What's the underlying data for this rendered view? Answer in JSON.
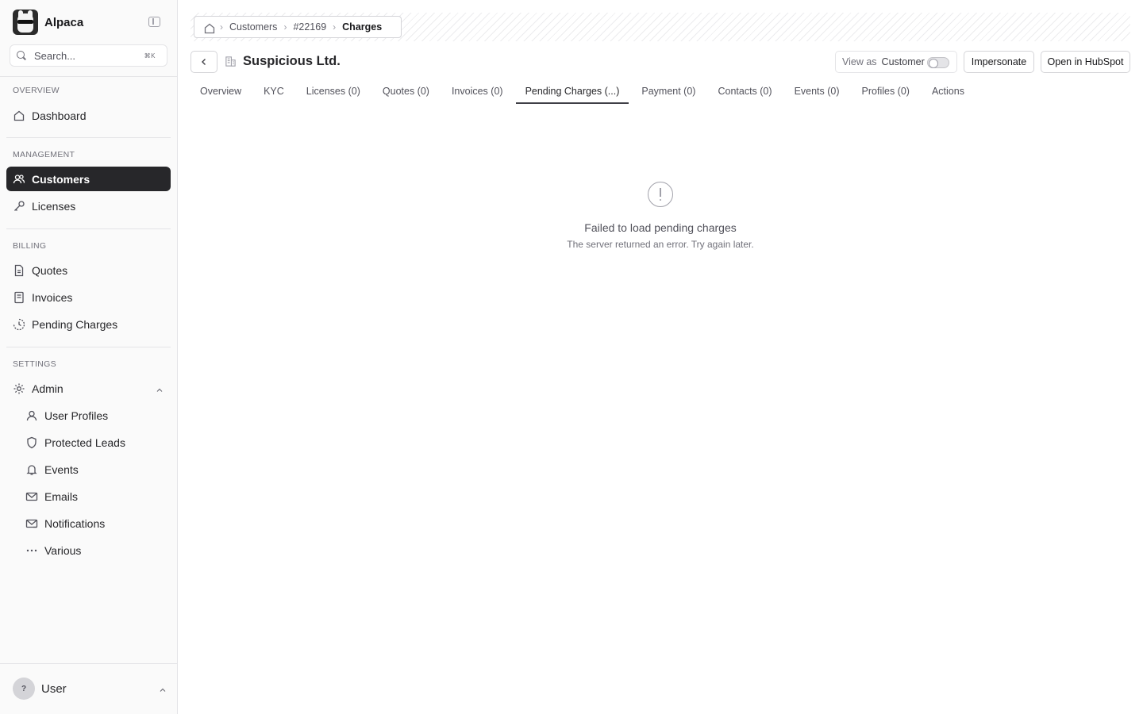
{
  "app": {
    "name": "Alpaca"
  },
  "search": {
    "placeholder": "Search...",
    "shortcut": "⌘K"
  },
  "sections": {
    "overview": "Overview",
    "management": "Management",
    "billing": "Billing",
    "settings": "Settings"
  },
  "nav": {
    "dashboard": "Dashboard",
    "customers": "Customers",
    "licenses": "Licenses",
    "quotes": "Quotes",
    "invoices": "Invoices",
    "pending_charges": "Pending Charges",
    "admin": "Admin",
    "user_profiles": "User Profiles",
    "protected_leads": "Protected Leads",
    "events": "Events",
    "emails": "Emails",
    "notifications": "Notifications",
    "various": "Various"
  },
  "user": {
    "initial": "?",
    "name": "User"
  },
  "breadcrumb": {
    "items": [
      "Customers",
      "#22169"
    ],
    "current": "Charges"
  },
  "page": {
    "title": "Suspicious Ltd."
  },
  "view_as": {
    "label": "View as",
    "value": "Customer",
    "enabled": false
  },
  "actions": {
    "impersonate": "Impersonate",
    "hubspot": "Open in HubSpot"
  },
  "tabs": [
    "Overview",
    "KYC",
    "Licenses (0)",
    "Quotes (0)",
    "Invoices (0)",
    "Pending Charges (...)",
    "Payment (0)",
    "Contacts (0)",
    "Events (0)",
    "Profiles (0)",
    "Actions"
  ],
  "active_tab": "Pending Charges (...)",
  "error": {
    "title": "Failed to load pending charges",
    "message": "The server returned an error. Try again later."
  },
  "colors": {
    "active_nav_bg": "#27272a",
    "sidebar_bg": "#fafafa",
    "border": "#e4e4e7"
  },
  "icons": {
    "dashboard": "home-icon",
    "customers": "users-icon",
    "licenses": "key-icon",
    "quotes": "document-icon",
    "invoices": "receipt-icon",
    "pending_charges": "clock-icon",
    "admin": "gear-icon",
    "user_profiles": "user-icon",
    "protected_leads": "shield-icon",
    "events": "bell-icon",
    "emails": "mail-icon",
    "notifications": "mail-notification-icon",
    "various": "more-icon"
  }
}
